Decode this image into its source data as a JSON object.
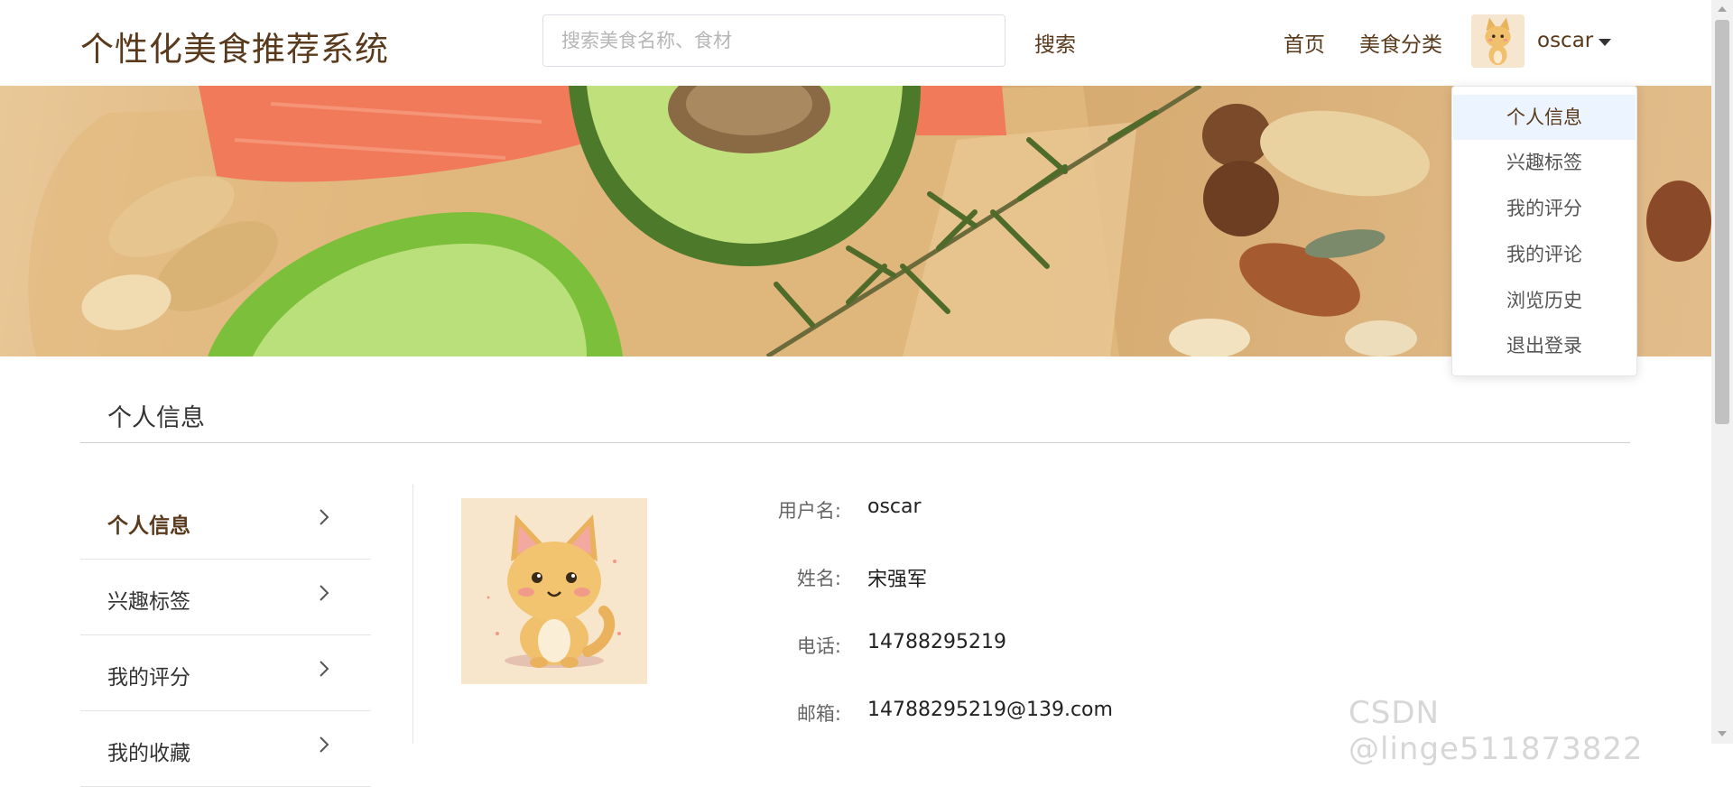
{
  "header": {
    "brand": "个性化美食推荐系统",
    "search_placeholder": "搜索美食名称、食材",
    "search_button": "搜索",
    "nav": {
      "home": "首页",
      "category": "美食分类"
    },
    "user_name": "oscar"
  },
  "user_menu": {
    "items": [
      "个人信息",
      "兴趣标签",
      "我的评分",
      "我的评论",
      "浏览历史",
      "退出登录"
    ],
    "active_index": 0
  },
  "page": {
    "section_title": "个人信息"
  },
  "sidebar": {
    "items": [
      "个人信息",
      "兴趣标签",
      "我的评分",
      "我的收藏"
    ],
    "active_index": 0
  },
  "profile": {
    "fields": [
      {
        "label": "用户名:",
        "value": "oscar"
      },
      {
        "label": "姓名:",
        "value": "宋强军"
      },
      {
        "label": "电话:",
        "value": "14788295219"
      },
      {
        "label": "邮箱:",
        "value": "14788295219@139.com"
      }
    ]
  },
  "watermark": "CSDN @linge511873822",
  "icons": {
    "avatar": "cartoon-kitten-avatar",
    "caret": "caret-down-icon",
    "chevron": "chevron-right-icon",
    "banner": "food-banner-avocado-salmon-nuts"
  },
  "colors": {
    "brand": "#5a3a1c",
    "menu_active_bg": "#ecf5ff"
  }
}
